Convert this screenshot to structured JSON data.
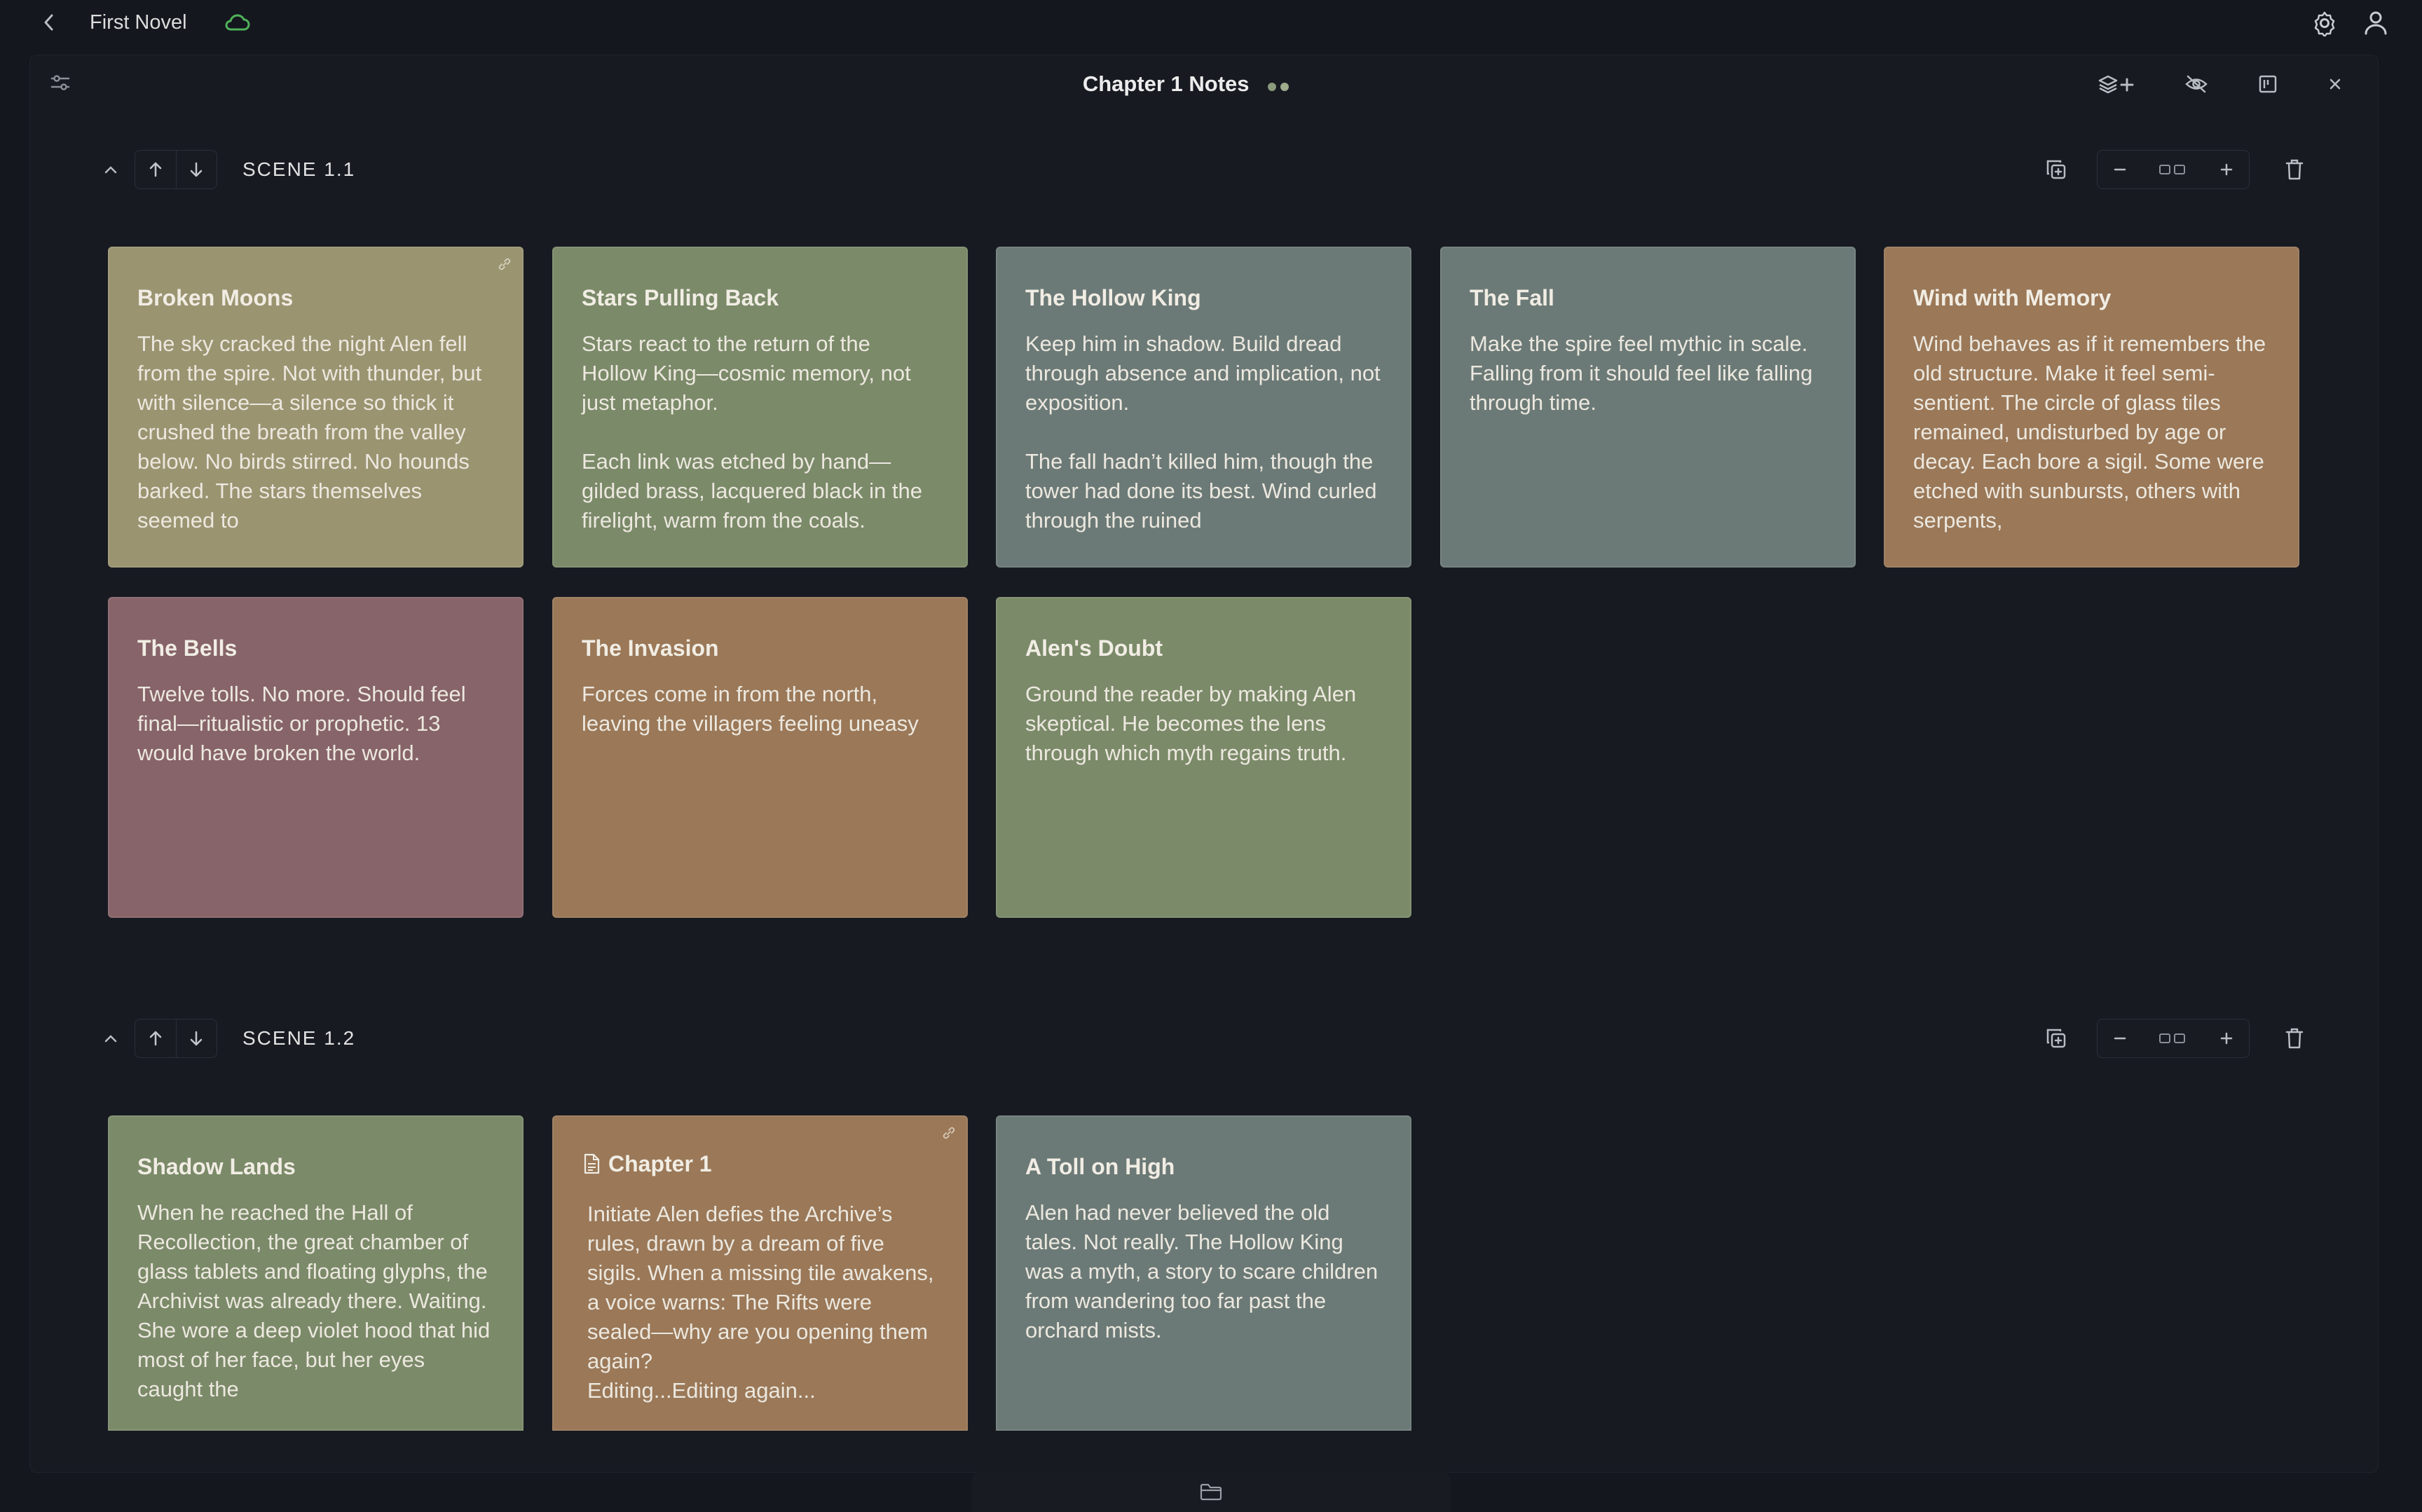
{
  "app": {
    "project_title": "First Novel"
  },
  "document": {
    "title": "Chapter 1 Notes"
  },
  "colors": {
    "sage": "#7b8a69",
    "khaki": "#9b9471",
    "slate": "#6c7a77",
    "copper": "#9a7858",
    "mauve": "#876469",
    "dot1": "#8b9a7a",
    "dot2": "#9eab8c"
  },
  "scenes": [
    {
      "label": "SCENE 1.1",
      "cards": [
        {
          "title": "Broken Moons",
          "body": "The sky cracked the night Alen fell from the spire. Not with thunder, but with silence—a silence so thick it crushed the breath from the valley below. No birds stirred. No hounds barked. The stars themselves seemed to",
          "color": "#9b9471"
        },
        {
          "title": "Stars Pulling Back",
          "body": "Stars react to the return of the Hollow King—cosmic memory, not just metaphor.\n\nEach link was etched by hand—gilded brass, lacquered black in the firelight, warm from the coals.",
          "color": "#7b8a69"
        },
        {
          "title": "The Hollow King",
          "body": "Keep him in shadow. Build dread through absence and implication, not exposition.\n\nThe fall hadn’t killed him, though the tower had done its best. Wind curled through the ruined",
          "color": "#6c7a77"
        },
        {
          "title": "The Fall",
          "body": "Make the spire feel mythic in scale. Falling from it should feel like falling through time.",
          "color": "#6c7a77"
        },
        {
          "title": "Wind with Memory",
          "body": "Wind behaves as if it remembers the old structure. Make it feel semi-sentient. The circle of glass tiles remained, undisturbed by age or decay. Each bore a sigil. Some were etched with sunbursts, others with serpents,",
          "color": "#9a7858"
        },
        {
          "title": "The Bells",
          "body": "Twelve tolls. No more. Should feel final—ritualistic or prophetic. 13 would have broken the world.",
          "color": "#876469"
        },
        {
          "title": "The Invasion",
          "body": "Forces come in from the north, leaving the villagers feeling uneasy",
          "color": "#9a7858"
        },
        {
          "title": "Alen's Doubt",
          "body": "Ground the reader by making Alen skeptical. He becomes the lens through which myth regains truth.",
          "color": "#7b8a69"
        }
      ]
    },
    {
      "label": "SCENE 1.2",
      "cards": [
        {
          "title": "Shadow Lands",
          "body": "When he reached the Hall of Recollection, the great chamber of glass tablets and floating glyphs, the Archivist was already there. Waiting. She wore a deep violet hood that hid most of her face, but her eyes caught the",
          "color": "#7b8a69"
        },
        {
          "title": "Chapter 1",
          "body": "Initiate Alen defies the Archive’s rules, drawn by a dream of five sigils. When a missing tile awakens, a voice warns: The Rifts were sealed—why are you opening them again?\nEditing...Editing again...",
          "color": "#9a7858"
        },
        {
          "title": "A Toll on High",
          "body": "Alen had never believed the old tales. Not really. The Hollow King was a myth, a story to scare children from wandering too far past the orchard mists.",
          "color": "#6c7a77"
        }
      ]
    }
  ]
}
